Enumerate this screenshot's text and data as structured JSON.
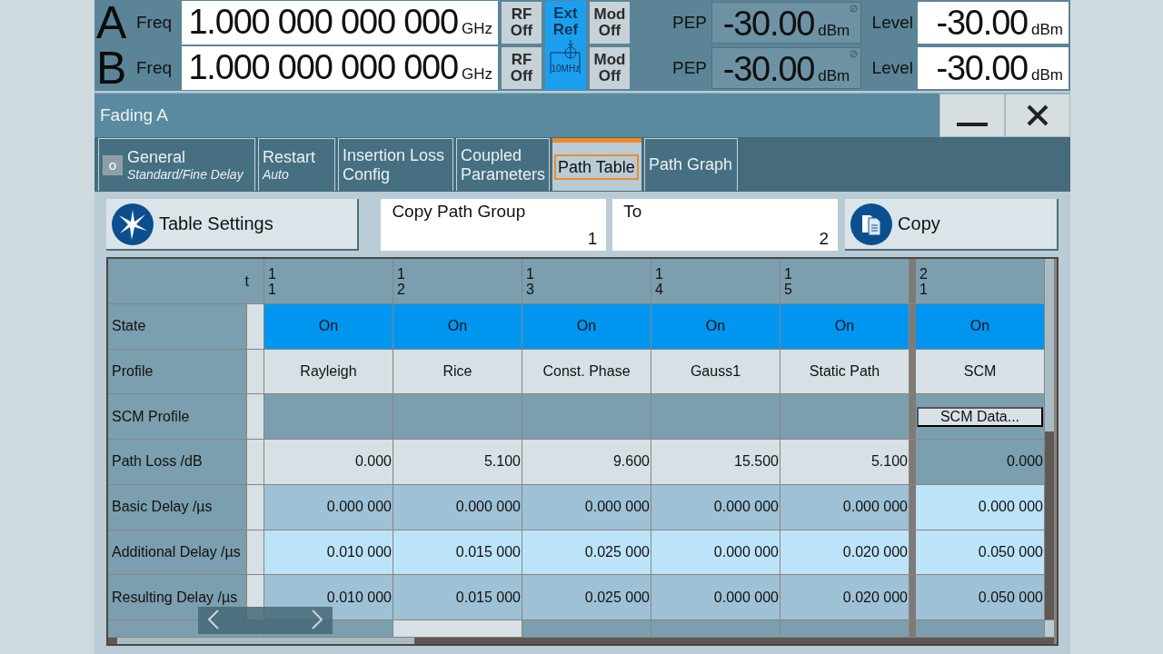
{
  "header": {
    "channels": [
      {
        "letter": "A",
        "freq_label": "Freq",
        "freq": "1.000 000 000 000",
        "freq_unit": "GHz",
        "rf_button": "RF Off",
        "mod_button": "Mod Off",
        "pep_label": "PEP",
        "pep": "-30.00",
        "pep_unit": "dBm",
        "level_label": "Level",
        "level": "-30.00",
        "level_unit": "dBm"
      },
      {
        "letter": "B",
        "freq_label": "Freq",
        "freq": "1.000 000 000 000",
        "freq_unit": "GHz",
        "rf_button": "RF Off",
        "mod_button": "Mod Off",
        "pep_label": "PEP",
        "pep": "-30.00",
        "pep_unit": "dBm",
        "level_label": "Level",
        "level": "-30.00",
        "level_unit": "dBm"
      }
    ],
    "ext_ref": {
      "label": "Ext Ref",
      "icon_label": "10MHz",
      "on": true
    }
  },
  "dialog": {
    "title": "Fading A",
    "tabs": [
      {
        "title": "General",
        "subtitle": "Standard/Fine Delay",
        "indicator": "o",
        "selected": false
      },
      {
        "title": "Restart",
        "subtitle": "Auto",
        "selected": false
      },
      {
        "title": "Insertion Loss Config",
        "selected": false
      },
      {
        "title": "Coupled Parameters",
        "selected": false
      },
      {
        "title": "Path Table",
        "selected": true
      },
      {
        "title": "Path Graph",
        "selected": false
      }
    ],
    "toolbar": {
      "table_settings": "Table Settings",
      "copy_from": {
        "label": "Copy Path Group",
        "value": "1"
      },
      "copy_to": {
        "label": "To",
        "value": "2"
      },
      "copy": "Copy"
    },
    "table": {
      "corner": "t",
      "columns": [
        {
          "group": "1",
          "path": "1",
          "group_start": false
        },
        {
          "group": "1",
          "path": "2",
          "group_start": false
        },
        {
          "group": "1",
          "path": "3",
          "group_start": false
        },
        {
          "group": "1",
          "path": "4",
          "group_start": false
        },
        {
          "group": "1",
          "path": "5",
          "group_start": false
        },
        {
          "group": "2",
          "path": "1",
          "group_start": true
        }
      ],
      "rows": [
        {
          "label": "State",
          "kind": "state",
          "cells": [
            "On",
            "On",
            "On",
            "On",
            "On",
            "On"
          ]
        },
        {
          "label": "Profile",
          "kind": "profile",
          "cells": [
            "Rayleigh",
            "Rice",
            "Const. Phase",
            "Gauss1",
            "Static Path",
            "SCM"
          ]
        },
        {
          "label": "SCM Profile",
          "kind": "scm",
          "cells": [
            null,
            null,
            null,
            null,
            null,
            "SCM Data..."
          ]
        },
        {
          "label": "Path Loss /dB",
          "kind": "loss",
          "cells": [
            "0.000",
            "5.100",
            "9.600",
            "15.500",
            "5.100",
            "0.000"
          ]
        },
        {
          "label": "Basic Delay /µs",
          "kind": "basic_delay",
          "cells": [
            "0.000 000",
            "0.000 000",
            "0.000 000",
            "0.000 000",
            "0.000 000",
            "0.000 000"
          ]
        },
        {
          "label": "Additional Delay /µs",
          "kind": "additional_delay",
          "cells": [
            "0.010 000",
            "0.015 000",
            "0.025 000",
            "0.000 000",
            "0.020 000",
            "0.050 000"
          ]
        },
        {
          "label": "Resulting Delay /µs",
          "kind": "resulting_delay",
          "cells": [
            "0.010 000",
            "0.015 000",
            "0.025 000",
            "0.000 000",
            "0.020 000",
            "0.050 000"
          ]
        }
      ]
    }
  }
}
